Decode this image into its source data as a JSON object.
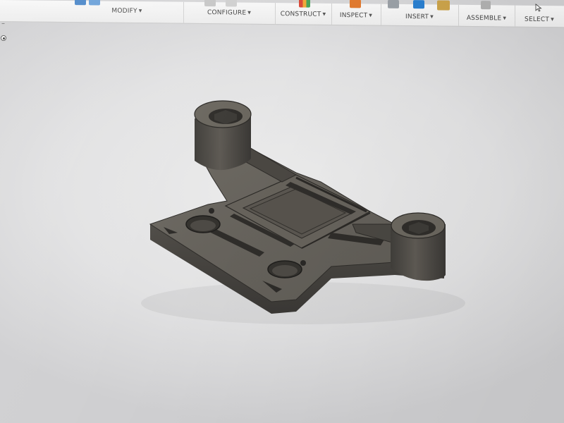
{
  "toolbar": {
    "groups": [
      {
        "label": "MODIFY"
      },
      {
        "label": "CONFIGURE"
      },
      {
        "label": "CONSTRUCT"
      },
      {
        "label": "INSPECT"
      },
      {
        "label": "INSERT"
      },
      {
        "label": "ASSEMBLE"
      },
      {
        "label": "SELECT"
      }
    ]
  },
  "colors": {
    "part_body": "#5b5852",
    "part_top": "#6a665f",
    "part_dark": "#3f3d39",
    "viewport_bg": "#e6e6e7"
  },
  "icons": {
    "modify": "push-pull-icon",
    "configure": "parameter-table-icon",
    "construct": "plane-icon",
    "inspect": "measure-icon",
    "insert": "insert-image-icon",
    "assemble": "joint-icon",
    "select": "cursor-arrow-icon"
  }
}
